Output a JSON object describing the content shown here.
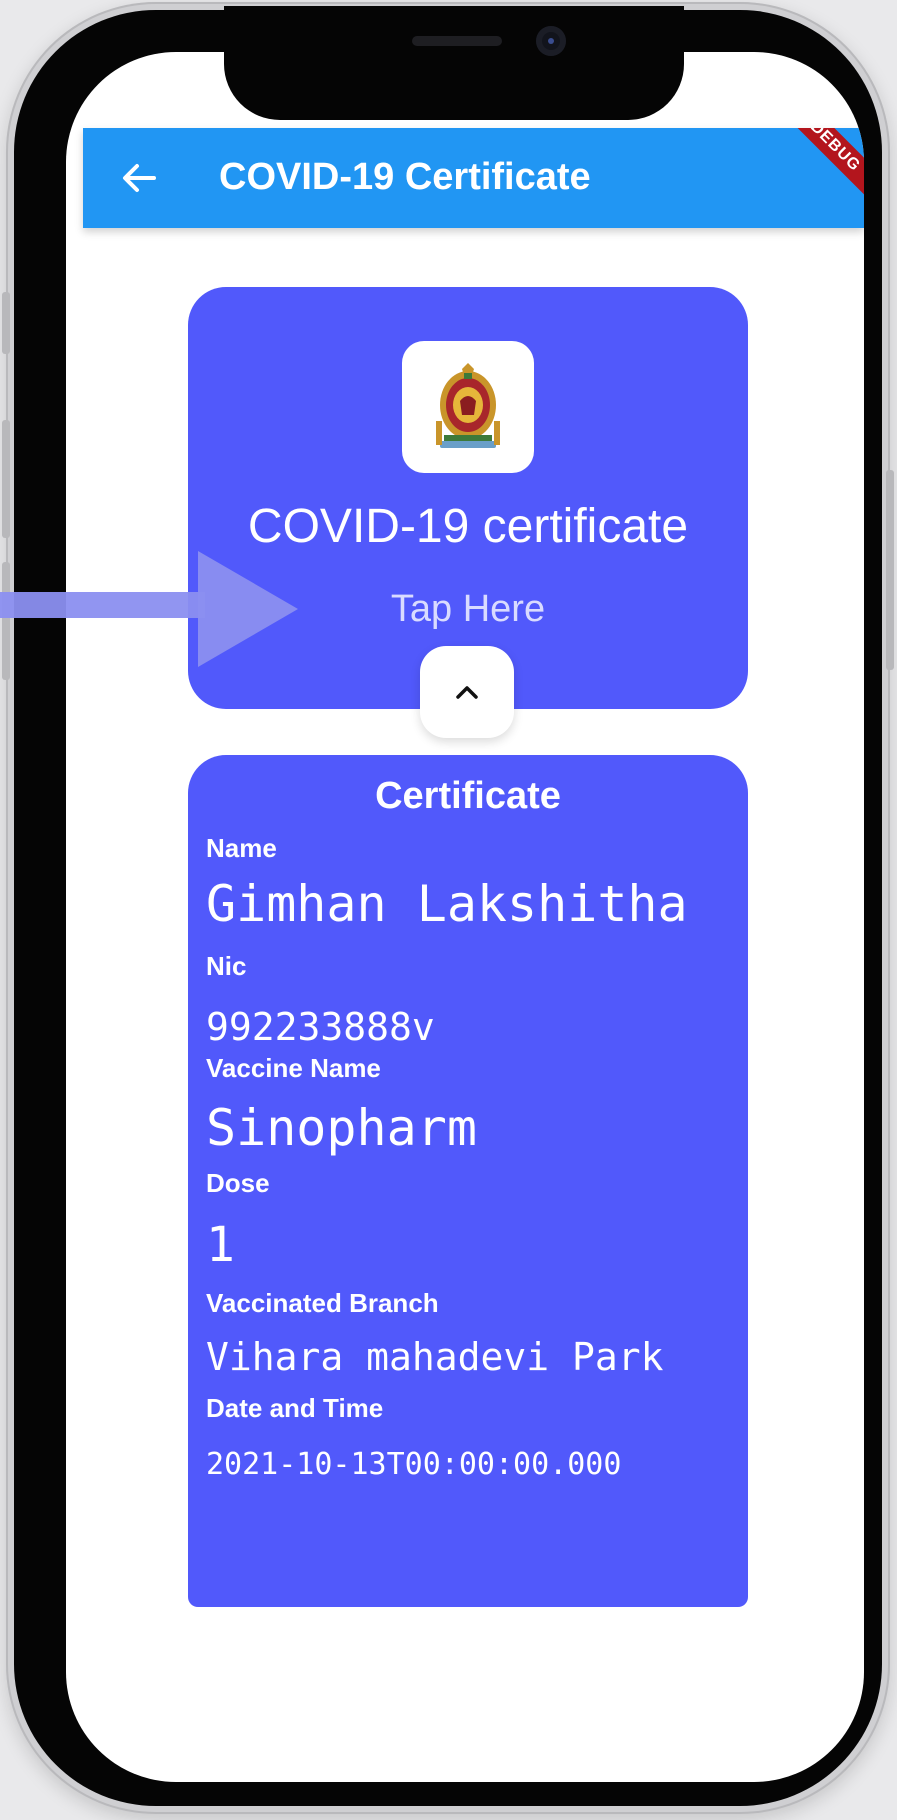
{
  "app_bar": {
    "title": "COVID-19 Certificate",
    "color": "#2196f3",
    "back_icon": "arrow-back-icon",
    "debug_banner": "DEBUG"
  },
  "certificate_card": {
    "emblem_icon": "sri-lanka-emblem-icon",
    "title": "COVID-19 certificate",
    "tap_hint": "Tap Here",
    "toggle_icon": "chevron-up-icon",
    "color": "#5159fb"
  },
  "certificate": {
    "heading": "Certificate",
    "fields": {
      "name": {
        "label": "Name",
        "value": "Gimhan Lakshitha"
      },
      "nic": {
        "label": "Nic",
        "value": "992233888v"
      },
      "vaccine_name": {
        "label": "Vaccine Name",
        "value": "Sinopharm"
      },
      "dose": {
        "label": "Dose",
        "value": "1"
      },
      "vaccinated_branch": {
        "label": "Vaccinated Branch",
        "value": "Vihara mahadevi Park"
      },
      "date_time": {
        "label": "Date and Time",
        "value": "2021-10-13T00:00:00.000"
      }
    }
  },
  "overlay": {
    "pointer_icon": "arrow-right-pointer-icon",
    "color": "#8b8ff0"
  }
}
